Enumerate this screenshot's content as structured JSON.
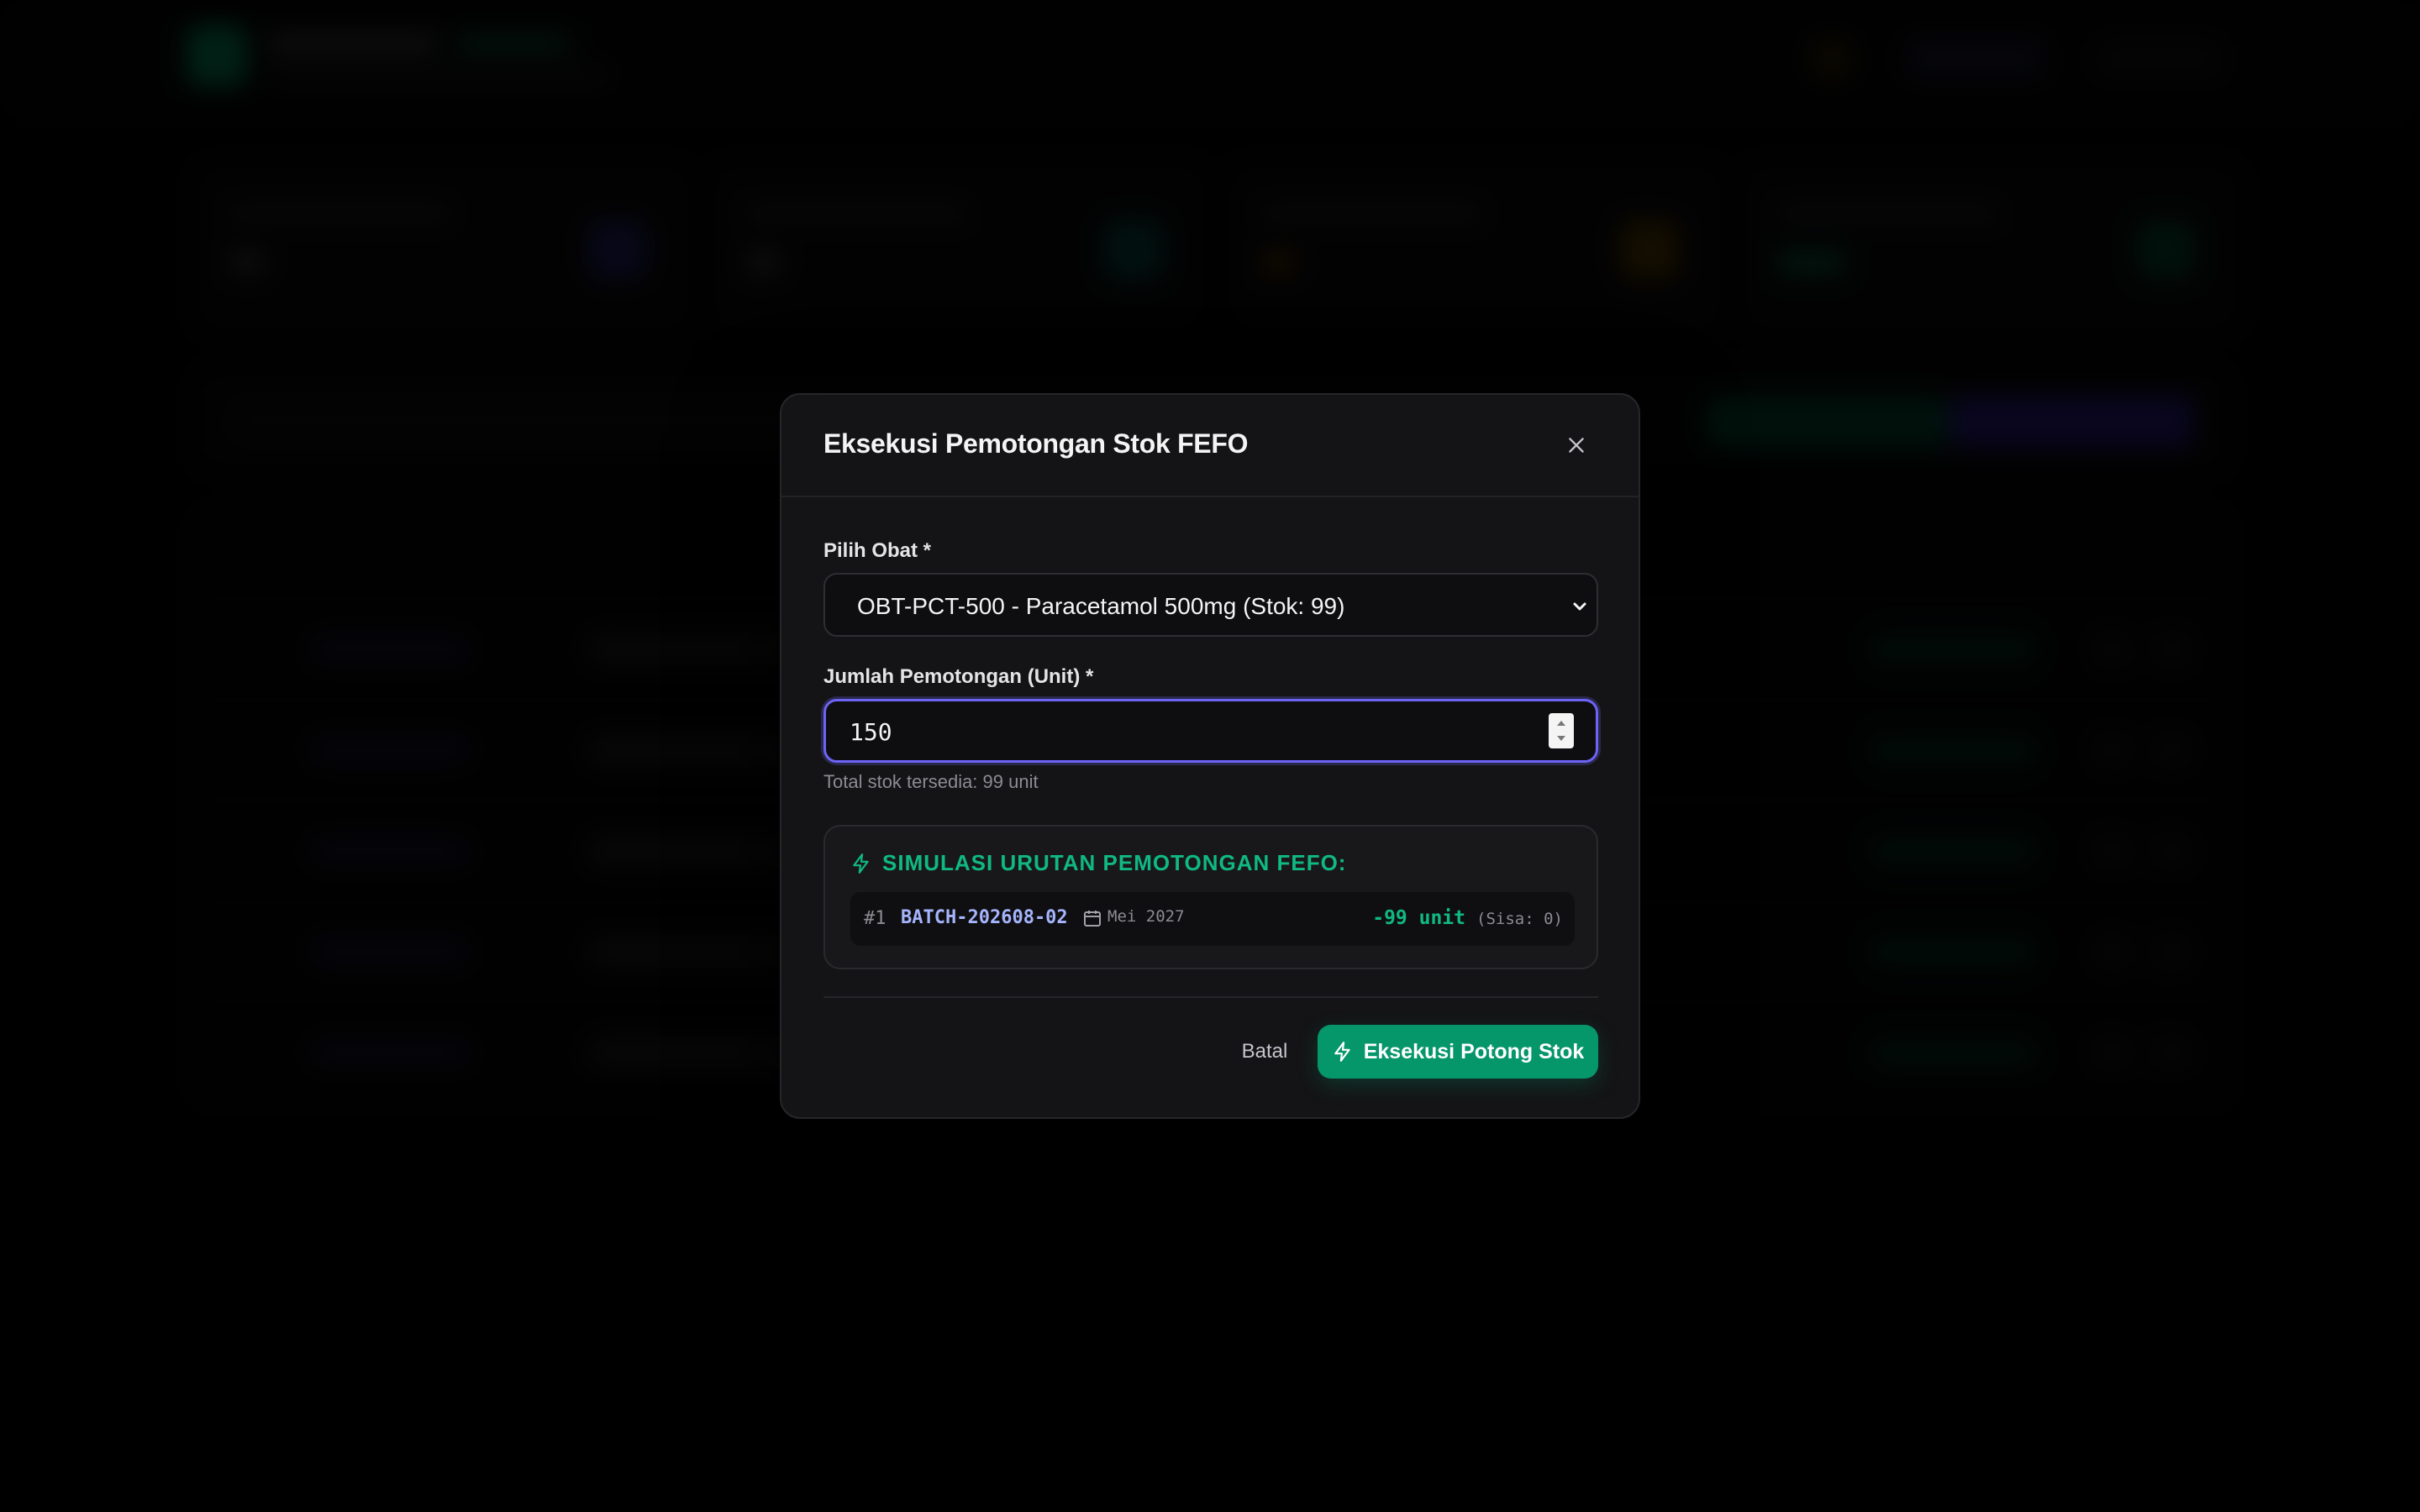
{
  "modal": {
    "title": "Eksekusi Pemotongan Stok FEFO",
    "close_icon": "close-icon"
  },
  "form": {
    "medicine_label": "Pilih Obat *",
    "medicine_selected": "OBT-PCT-500 - Paracetamol 500mg (Stok: 99)",
    "quantity_label": "Jumlah Pemotongan (Unit) *",
    "quantity_value": "150",
    "stock_helper": "Total stok tersedia: 99 unit"
  },
  "simulation": {
    "title": "SIMULASI URUTAN PEMOTONGAN FEFO:",
    "icon": "bolt-icon",
    "rows": [
      {
        "index": "#1",
        "batch": "BATCH-202608-02",
        "date": "Mei 2027",
        "quantity": "-99 unit",
        "remaining": "(Sisa: 0)"
      }
    ]
  },
  "actions": {
    "cancel_label": "Batal",
    "execute_label": "Eksekusi Potong Stok"
  },
  "colors": {
    "accent_green": "#059669",
    "accent_indigo": "#6d63f5",
    "batch_text": "#a5b4fc"
  }
}
